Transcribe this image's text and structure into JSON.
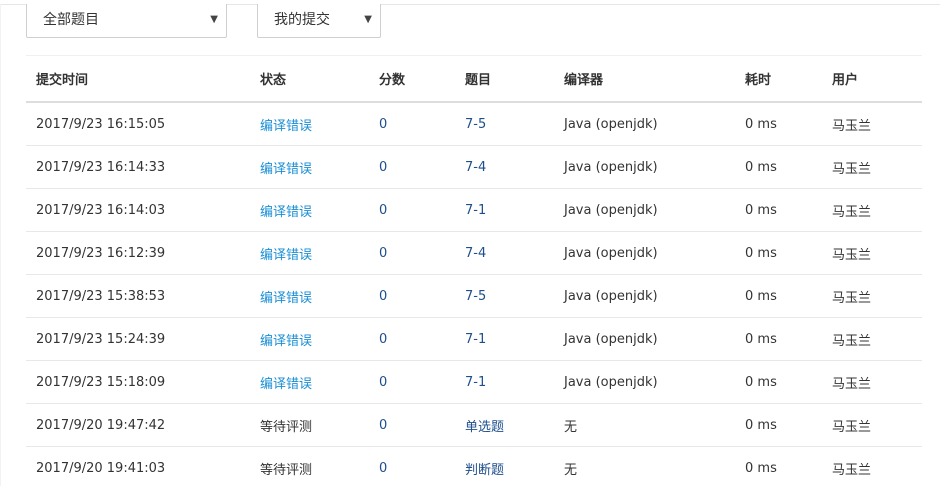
{
  "filters": {
    "problem_scope": "全部题目",
    "submission_scope": "我的提交"
  },
  "table": {
    "headers": {
      "time": "提交时间",
      "status": "状态",
      "score": "分数",
      "problem": "题目",
      "compiler": "编译器",
      "duration": "耗时",
      "user": "用户"
    },
    "rows": [
      {
        "time": "2017/9/23 16:15:05",
        "status": "编译错误",
        "score": "0",
        "problem": "7-5",
        "compiler": "Java (openjdk)",
        "duration": "0 ms",
        "user": "马玉兰"
      },
      {
        "time": "2017/9/23 16:14:33",
        "status": "编译错误",
        "score": "0",
        "problem": "7-4",
        "compiler": "Java (openjdk)",
        "duration": "0 ms",
        "user": "马玉兰"
      },
      {
        "time": "2017/9/23 16:14:03",
        "status": "编译错误",
        "score": "0",
        "problem": "7-1",
        "compiler": "Java (openjdk)",
        "duration": "0 ms",
        "user": "马玉兰"
      },
      {
        "time": "2017/9/23 16:12:39",
        "status": "编译错误",
        "score": "0",
        "problem": "7-4",
        "compiler": "Java (openjdk)",
        "duration": "0 ms",
        "user": "马玉兰"
      },
      {
        "time": "2017/9/23 15:38:53",
        "status": "编译错误",
        "score": "0",
        "problem": "7-5",
        "compiler": "Java (openjdk)",
        "duration": "0 ms",
        "user": "马玉兰"
      },
      {
        "time": "2017/9/23 15:24:39",
        "status": "编译错误",
        "score": "0",
        "problem": "7-1",
        "compiler": "Java (openjdk)",
        "duration": "0 ms",
        "user": "马玉兰"
      },
      {
        "time": "2017/9/23 15:18:09",
        "status": "编译错误",
        "score": "0",
        "problem": "7-1",
        "compiler": "Java (openjdk)",
        "duration": "0 ms",
        "user": "马玉兰"
      },
      {
        "time": "2017/9/20 19:47:42",
        "status": "等待评测",
        "score": "0",
        "problem": "单选题",
        "compiler": "无",
        "duration": "0 ms",
        "user": "马玉兰"
      },
      {
        "time": "2017/9/20 19:41:03",
        "status": "等待评测",
        "score": "0",
        "problem": "判断题",
        "compiler": "无",
        "duration": "0 ms",
        "user": "马玉兰"
      }
    ]
  },
  "colors": {
    "status_link": "#1a8fd6",
    "problem_link": "#1e4f8c",
    "text": "#333333",
    "row_border": "#e8e8e8"
  }
}
